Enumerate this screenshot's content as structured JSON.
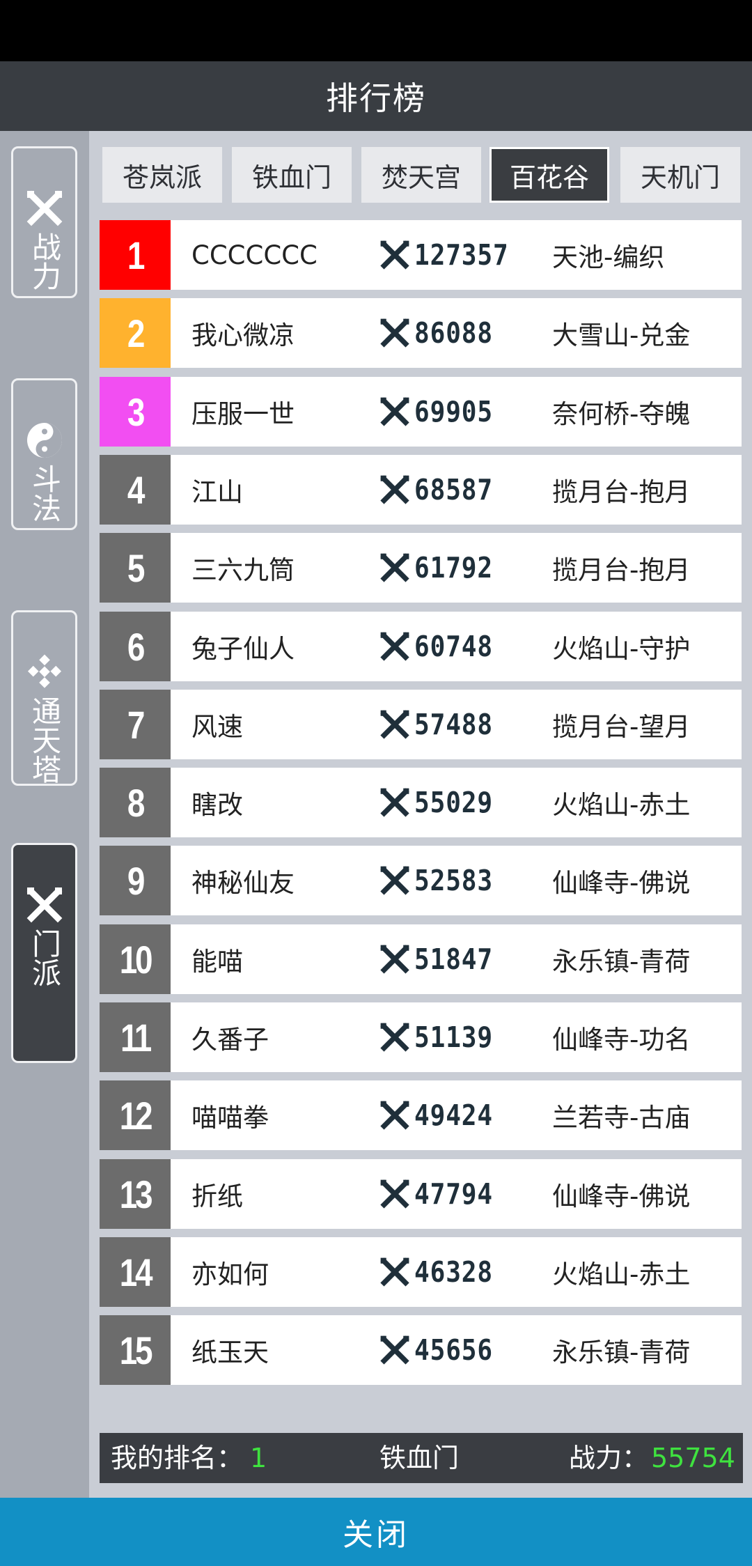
{
  "title": "排行榜",
  "side_tabs": [
    {
      "label": "战力",
      "icon": "crossed-swords-icon",
      "active": false
    },
    {
      "label": "斗法",
      "icon": "yin-yang-icon",
      "active": false
    },
    {
      "label": "通天塔",
      "icon": "checker-icon",
      "active": false
    },
    {
      "label": "门派",
      "icon": "crossed-swords-icon",
      "active": true
    }
  ],
  "sect_tabs": [
    {
      "label": "苍岚派",
      "active": false
    },
    {
      "label": "铁血门",
      "active": false
    },
    {
      "label": "焚天宫",
      "active": false
    },
    {
      "label": "百花谷",
      "active": true
    },
    {
      "label": "天机门",
      "active": false
    }
  ],
  "rank_colors": {
    "1": "#ff0000",
    "2": "#ffb22e",
    "3": "#f24ef2",
    "other": "#6c6c6c"
  },
  "rows": [
    {
      "rank": "1",
      "name": "CCCCCCC",
      "power": "127357",
      "server": "天池-编织"
    },
    {
      "rank": "2",
      "name": "我心微凉",
      "power": "86088",
      "server": "大雪山-兑金"
    },
    {
      "rank": "3",
      "name": "压服一世",
      "power": "69905",
      "server": "奈何桥-夺魄"
    },
    {
      "rank": "4",
      "name": "江山",
      "power": "68587",
      "server": "揽月台-抱月"
    },
    {
      "rank": "5",
      "name": "三六九筒",
      "power": "61792",
      "server": "揽月台-抱月"
    },
    {
      "rank": "6",
      "name": "兔子仙人",
      "power": "60748",
      "server": "火焰山-守护"
    },
    {
      "rank": "7",
      "name": "风速",
      "power": "57488",
      "server": "揽月台-望月"
    },
    {
      "rank": "8",
      "name": "瞎改",
      "power": "55029",
      "server": "火焰山-赤土"
    },
    {
      "rank": "9",
      "name": "神秘仙友",
      "power": "52583",
      "server": "仙峰寺-佛说"
    },
    {
      "rank": "10",
      "name": "能喵",
      "power": "51847",
      "server": "永乐镇-青荷"
    },
    {
      "rank": "11",
      "name": "久番子",
      "power": "51139",
      "server": "仙峰寺-功名"
    },
    {
      "rank": "12",
      "name": "喵喵拳",
      "power": "49424",
      "server": "兰若寺-古庙"
    },
    {
      "rank": "13",
      "name": "折纸",
      "power": "47794",
      "server": "仙峰寺-佛说"
    },
    {
      "rank": "14",
      "name": "亦如何",
      "power": "46328",
      "server": "火焰山-赤土"
    },
    {
      "rank": "15",
      "name": "纸玉天",
      "power": "45656",
      "server": "永乐镇-青荷"
    }
  ],
  "footer": {
    "my_rank_label": "我的排名：",
    "my_rank_value": "1",
    "sect": "铁血门",
    "power_label": "战力：",
    "power_value": "55754"
  },
  "close_label": "关闭"
}
